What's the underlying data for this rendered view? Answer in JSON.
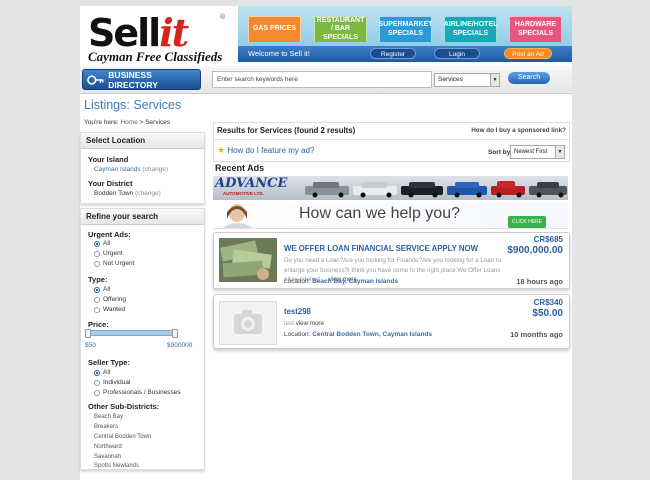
{
  "brand": {
    "name_main": "Sell",
    "name_accent": "it",
    "reg": "®",
    "tagline": "Cayman Free Classifieds"
  },
  "nav": [
    {
      "label": "GAS PRICES",
      "color": "#f28b2f"
    },
    {
      "label": "RESTAURANT / BAR SPECIALS",
      "color": "#7bb842"
    },
    {
      "label": "SUPERMARKET SPECIALS",
      "color": "#2b9ad6"
    },
    {
      "label": "AIRLINE/HOTEL SPECIALS",
      "color": "#18a9b8"
    },
    {
      "label": "HARDWARE SPECIALS",
      "color": "#e7557c"
    }
  ],
  "userbar": {
    "welcome": "Welcome to Sell it!",
    "register": "Register",
    "login": "Login",
    "post_ad": "Post an Ad"
  },
  "search": {
    "directory_label": "BUSINESS DIRECTORY",
    "placeholder": "Enter search keywords here",
    "category": "Services",
    "button": "Search"
  },
  "page": {
    "title": "Listings: Services",
    "crumb_prefix": "You're here:",
    "crumb_home": "Home",
    "crumb_sep": ">",
    "crumb_current": "Services"
  },
  "location": {
    "header": "Select Location",
    "island_label": "Your Island",
    "island_value": "Cayman Islands",
    "island_change": "(change)",
    "district_label": "Your District",
    "district_value": "Bodden Town",
    "district_change": "(change)"
  },
  "refine": {
    "header": "Refine your search",
    "urgent_label": "Urgent Ads:",
    "urgent_options": [
      "All",
      "Urgent",
      "Not Urgent"
    ],
    "type_label": "Type:",
    "type_options": [
      "All",
      "Offering",
      "Wanted"
    ],
    "price_label": "Price:",
    "price_min": "$50",
    "price_max": "$900000",
    "seller_label": "Seller Type:",
    "seller_options": [
      "All",
      "Individual",
      "Professionals / Businesses"
    ],
    "subdistricts_label": "Other Sub-Districts:",
    "subdistricts": [
      "Beach Bay",
      "Breakers",
      "Central Bodden Town",
      "Northward",
      "Savannah",
      "Spotts Newlands"
    ]
  },
  "results": {
    "summary": "Results for Services (found 2 results)",
    "sponsored_link": "How do I buy a sponsored link?",
    "feature_link": "How do I feature my ad?",
    "sort_label": "Sort by:",
    "sort_value": "Newest First"
  },
  "recent": {
    "header": "Recent Ads",
    "banner1_text": "ADVANCE",
    "banner1_sub": "AUTOMOTIVE LTD.",
    "banner2_text": "How can we help you?",
    "banner2_btn": "CLICK HERE"
  },
  "listings": [
    {
      "title": "WE OFFER LOAN FINANCIAL SERVICE APPLY NOW",
      "cr": "CR$685",
      "price": "$900,000.00",
      "desc": "Do you need a Loan?Are you looking for Finance?Are you looking for a Loan to enlarge your business?I think you have come to the right place.We Offer Loans allow interest ...",
      "more": "view more",
      "loc_label": "Location:",
      "loc_area": "Beach Bay",
      "loc_sep": ",",
      "loc_island": "Cayman Islands",
      "time": "18 hours ago"
    },
    {
      "title": "test298",
      "cr": "CR$340",
      "price": "$50.00",
      "desc": "test",
      "more": "view more",
      "loc_label": "Location:",
      "loc_area": "Central Bodden Town",
      "loc_sep": ",",
      "loc_island": "Cayman Islands",
      "time": "10 months ago"
    }
  ]
}
